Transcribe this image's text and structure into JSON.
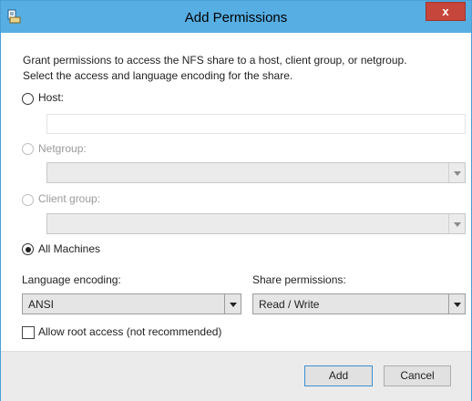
{
  "window": {
    "title": "Add Permissions",
    "close_label": "x"
  },
  "intro": {
    "line1": "Grant permissions to access the NFS share to a host, client group, or netgroup.",
    "line2": "Select the access and language encoding for the share."
  },
  "options": {
    "host": {
      "label": "Host:",
      "selected": false,
      "enabled": true,
      "value": ""
    },
    "netgroup": {
      "label": "Netgroup:",
      "selected": false,
      "enabled": false,
      "value": ""
    },
    "client_group": {
      "label": "Client group:",
      "selected": false,
      "enabled": false,
      "value": ""
    },
    "all_machines": {
      "label": "All Machines",
      "selected": true,
      "enabled": true
    }
  },
  "language": {
    "label": "Language encoding:",
    "value": "ANSI"
  },
  "share_permissions": {
    "label": "Share permissions:",
    "value": "Read / Write"
  },
  "root_access": {
    "label": "Allow root access (not recommended)",
    "checked": false
  },
  "buttons": {
    "add": "Add",
    "cancel": "Cancel"
  }
}
